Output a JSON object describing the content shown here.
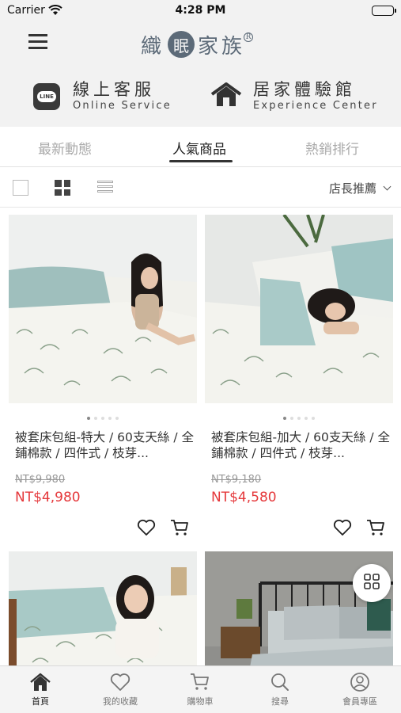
{
  "status_bar": {
    "carrier": "Carrier",
    "time": "4:28 PM"
  },
  "header": {
    "logo": {
      "left": "織",
      "mid": "眠",
      "right": "家族",
      "mark": "R"
    },
    "services": [
      {
        "zh": "線上客服",
        "en": "Online Service",
        "icon": "line-icon",
        "icon_text": "LINE"
      },
      {
        "zh": "居家體驗館",
        "en": "Experience Center",
        "icon": "house-icon"
      }
    ]
  },
  "tabs": [
    {
      "label": "最新動態",
      "active": false
    },
    {
      "label": "人氣商品",
      "active": true
    },
    {
      "label": "熱銷排行",
      "active": false
    }
  ],
  "view_bar": {
    "sort_label": "店長推薦",
    "active_view": "grid"
  },
  "products": [
    {
      "name": "被套床包組-特大 / 60支天絲 / 全鋪棉款 / 四件式 / 枝芽...",
      "old_price": "NT$9,980",
      "price": "NT$4,980"
    },
    {
      "name": "被套床包組-加大 / 60支天絲 / 全鋪棉款 / 四件式 / 枝芽...",
      "old_price": "NT$9,180",
      "price": "NT$4,580"
    },
    {
      "name": "",
      "old_price": "",
      "price": ""
    },
    {
      "name": "",
      "old_price": "",
      "price": ""
    }
  ],
  "bottom_nav": [
    {
      "label": "首頁",
      "icon": "home-icon",
      "active": true
    },
    {
      "label": "我的收藏",
      "icon": "heart-icon",
      "active": false
    },
    {
      "label": "購物車",
      "icon": "cart-icon",
      "active": false
    },
    {
      "label": "搜尋",
      "icon": "search-icon",
      "active": false
    },
    {
      "label": "會員專區",
      "icon": "user-icon",
      "active": false
    }
  ],
  "colors": {
    "sale_price": "#e5383b",
    "logo": "#5c6a78",
    "header_bg": "#f2f2f2"
  }
}
